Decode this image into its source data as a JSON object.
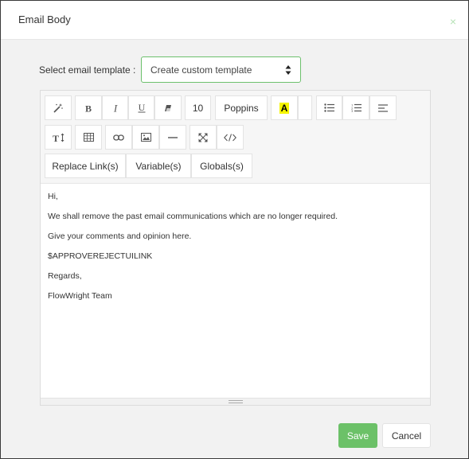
{
  "dialog": {
    "title": "Email Body",
    "close_glyph": "×"
  },
  "template": {
    "label": "Select email template :",
    "selected": "Create custom template"
  },
  "toolbar": {
    "font_size": "10",
    "font_family": "Poppins",
    "color_letter": "A",
    "color_highlight": "#f5f500",
    "replace_link_label": "Replace Link(s)",
    "variable_label": "Variable(s)",
    "globals_label": "Globals(s)",
    "icons": [
      "magic-wand-icon",
      "bold-icon",
      "italic-icon",
      "underline-icon",
      "eraser-icon",
      "text-color-icon",
      "unordered-list-icon",
      "ordered-list-icon",
      "align-icon",
      "text-height-icon",
      "table-icon",
      "link-icon",
      "picture-icon",
      "horizontal-rule-icon",
      "fullscreen-icon",
      "code-view-icon"
    ]
  },
  "body": {
    "lines": [
      "Hi,",
      "We shall remove the past email communications which are no longer required.",
      "Give your comments and opinion here.",
      "$APPROVEREJECTUILINK",
      "Regards,",
      "FlowWright Team"
    ]
  },
  "footer": {
    "save_label": "Save",
    "cancel_label": "Cancel"
  },
  "colors": {
    "accent": "#6cc168",
    "border_accent": "#6cc06c"
  }
}
